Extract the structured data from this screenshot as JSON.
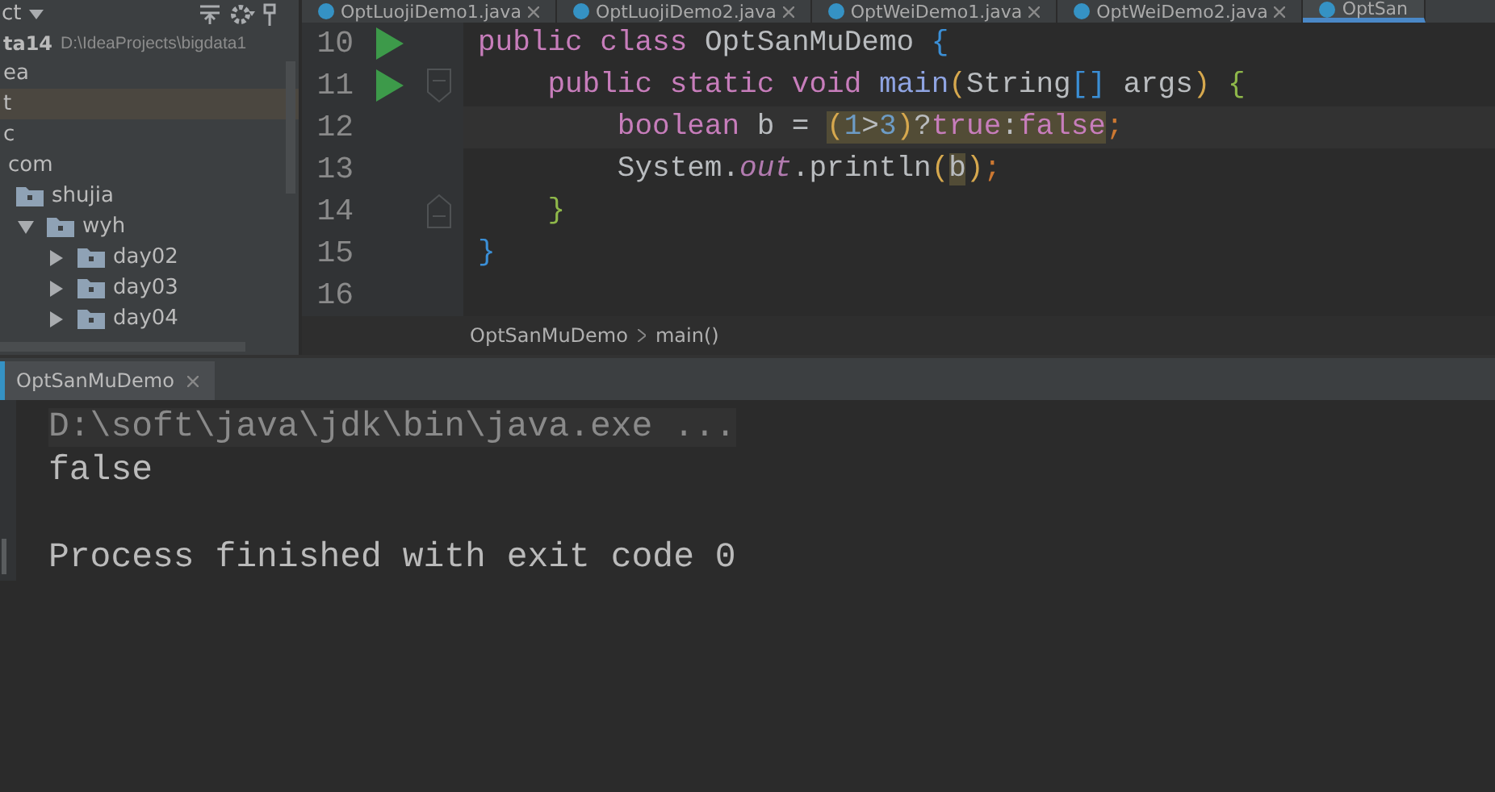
{
  "project_panel": {
    "title": "ct",
    "tree": [
      {
        "label": "ta14",
        "path": "D:\\IdeaProjects\\bigdata1",
        "selected": false,
        "children": [
          {
            "label": "ea",
            "selected": false
          },
          {
            "label": "t",
            "selected": true
          },
          {
            "label": "c",
            "selected": false,
            "children": [
              {
                "label": "com",
                "selected": false,
                "children": [
                  {
                    "label": "shujia",
                    "selected": false,
                    "children": [
                      {
                        "label": "wyh",
                        "selected": false,
                        "expanded": true,
                        "children": [
                          {
                            "label": "day02",
                            "selected": false,
                            "expanded": false
                          },
                          {
                            "label": "day03",
                            "selected": false,
                            "expanded": false
                          },
                          {
                            "label": "day04",
                            "selected": false,
                            "expanded": false
                          }
                        ]
                      }
                    ]
                  }
                ]
              }
            ]
          }
        ]
      }
    ]
  },
  "editor_tabs": [
    {
      "label": "OptLuojiDemo1.java",
      "selected": false
    },
    {
      "label": "OptLuojiDemo2.java",
      "selected": false
    },
    {
      "label": "OptWeiDemo1.java",
      "selected": false
    },
    {
      "label": "OptWeiDemo2.java",
      "selected": false
    },
    {
      "label": "OptSan",
      "selected": true
    }
  ],
  "code_lines": [
    {
      "number": "10",
      "run_marker": true,
      "current": false,
      "tokens": [
        {
          "text": "public class ",
          "kind": "keyword",
          "highlighted": false
        },
        {
          "text": "OptSanMuDemo ",
          "kind": "plain",
          "highlighted": false
        },
        {
          "text": "{",
          "kind": "bracket1",
          "highlighted": false
        }
      ]
    },
    {
      "number": "11",
      "run_marker": true,
      "current": false,
      "fold_start": true,
      "tokens": [
        {
          "text": "    public static void ",
          "kind": "keyword",
          "highlighted": false
        },
        {
          "text": "main",
          "kind": "method",
          "highlighted": false
        },
        {
          "text": "(",
          "kind": "paren",
          "highlighted": false
        },
        {
          "text": "String",
          "kind": "plain",
          "highlighted": false
        },
        {
          "text": "[]",
          "kind": "bracket1",
          "highlighted": false
        },
        {
          "text": " args",
          "kind": "plain",
          "highlighted": false
        },
        {
          "text": ")",
          "kind": "paren",
          "highlighted": false
        },
        {
          "text": " {",
          "kind": "bracket2",
          "highlighted": false
        }
      ]
    },
    {
      "number": "12",
      "run_marker": false,
      "current": true,
      "tokens": [
        {
          "text": "        boolean",
          "kind": "keyword",
          "highlighted": false
        },
        {
          "text": " b = ",
          "kind": "plain",
          "highlighted": false
        },
        {
          "text": "(",
          "kind": "paren",
          "highlighted": true
        },
        {
          "text": "1",
          "kind": "number",
          "highlighted": true
        },
        {
          "text": ">",
          "kind": "plain",
          "highlighted": true
        },
        {
          "text": "3",
          "kind": "number",
          "highlighted": true
        },
        {
          "text": ")",
          "kind": "paren",
          "highlighted": true
        },
        {
          "text": "?",
          "kind": "plain",
          "highlighted": true
        },
        {
          "text": "true",
          "kind": "keyword",
          "highlighted": true
        },
        {
          "text": ":",
          "kind": "plain",
          "highlighted": true
        },
        {
          "text": "false",
          "kind": "keyword",
          "highlighted": true
        },
        {
          "text": ";",
          "kind": "punct",
          "highlighted": false
        }
      ]
    },
    {
      "number": "13",
      "run_marker": false,
      "current": false,
      "tokens": [
        {
          "text": "        System.",
          "kind": "plain",
          "highlighted": false
        },
        {
          "text": "out",
          "kind": "field",
          "highlighted": false
        },
        {
          "text": ".println",
          "kind": "plain",
          "highlighted": false
        },
        {
          "text": "(",
          "kind": "paren",
          "highlighted": false
        },
        {
          "text": "b",
          "kind": "plain",
          "highlighted": true
        },
        {
          "text": ")",
          "kind": "paren",
          "highlighted": false
        },
        {
          "text": ";",
          "kind": "punct",
          "highlighted": false
        }
      ]
    },
    {
      "number": "14",
      "run_marker": false,
      "current": false,
      "fold_end": true,
      "tokens": [
        {
          "text": "    }",
          "kind": "bracket2",
          "highlighted": false
        }
      ]
    },
    {
      "number": "15",
      "run_marker": false,
      "current": false,
      "tokens": [
        {
          "text": "}",
          "kind": "bracket1",
          "highlighted": false
        }
      ]
    },
    {
      "number": "16",
      "run_marker": false,
      "current": false
    }
  ],
  "breadcrumb": [
    "OptSanMuDemo",
    "main()"
  ],
  "run_panel": {
    "tab": {
      "label": "OptSanMuDemo",
      "selected": true
    },
    "lines": [
      {
        "text": "D:\\soft\\java\\jdk\\bin\\java.exe ...",
        "kind": "command"
      },
      {
        "text": "false",
        "kind": "output"
      },
      {
        "kind": "blank"
      },
      {
        "text": "Process finished with exit code 0",
        "kind": "output"
      }
    ]
  }
}
